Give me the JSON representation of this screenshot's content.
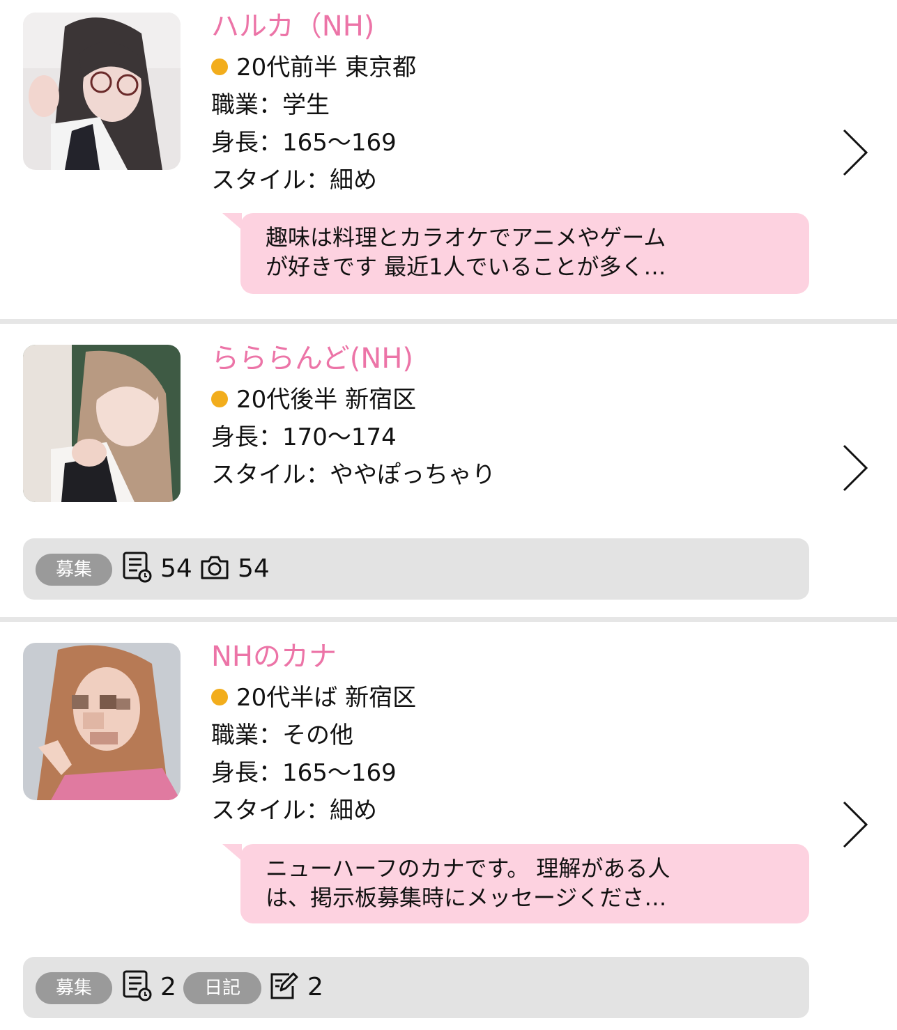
{
  "profiles": [
    {
      "name": "ハルカ（NH)",
      "age_location": "20代前半 東京都",
      "occupation": "職業：学生",
      "height": "身長：165〜169",
      "style": "スタイル：細め",
      "message_line1": "趣味は料理とカラオケでアニメやゲーム",
      "message_line2": "が好きです 最近1人でいることが多く…"
    },
    {
      "name": "らららんど(NH)",
      "age_location": "20代後半 新宿区",
      "height": "身長：170〜174",
      "style": "スタイル：ややぽっちゃり",
      "tag_recruit": "募集",
      "recruit_count": "54",
      "photo_count": "54"
    },
    {
      "name": "NHのカナ",
      "age_location": "20代半ば 新宿区",
      "occupation": "職業：その他",
      "height": "身長：165〜169",
      "style": "スタイル：細め",
      "message_line1": "ニューハーフのカナです。 理解がある人",
      "message_line2": "は、掲示板募集時にメッセージくださ…",
      "tag_recruit": "募集",
      "recruit_count": "2",
      "tag_diary": "日記",
      "diary_count": "2"
    }
  ],
  "icons": {
    "online_dot": "status-dot",
    "recruit": "bulletin-board-icon",
    "photo": "camera-icon",
    "diary": "edit-note-icon",
    "more": "chevron-right-icon"
  },
  "colors": {
    "name": "#ec74a7",
    "status_dot": "#f2ad1c",
    "bubble": "#fdd2e0",
    "bar": "#e3e3e3",
    "tag": "#9a9a9a"
  }
}
